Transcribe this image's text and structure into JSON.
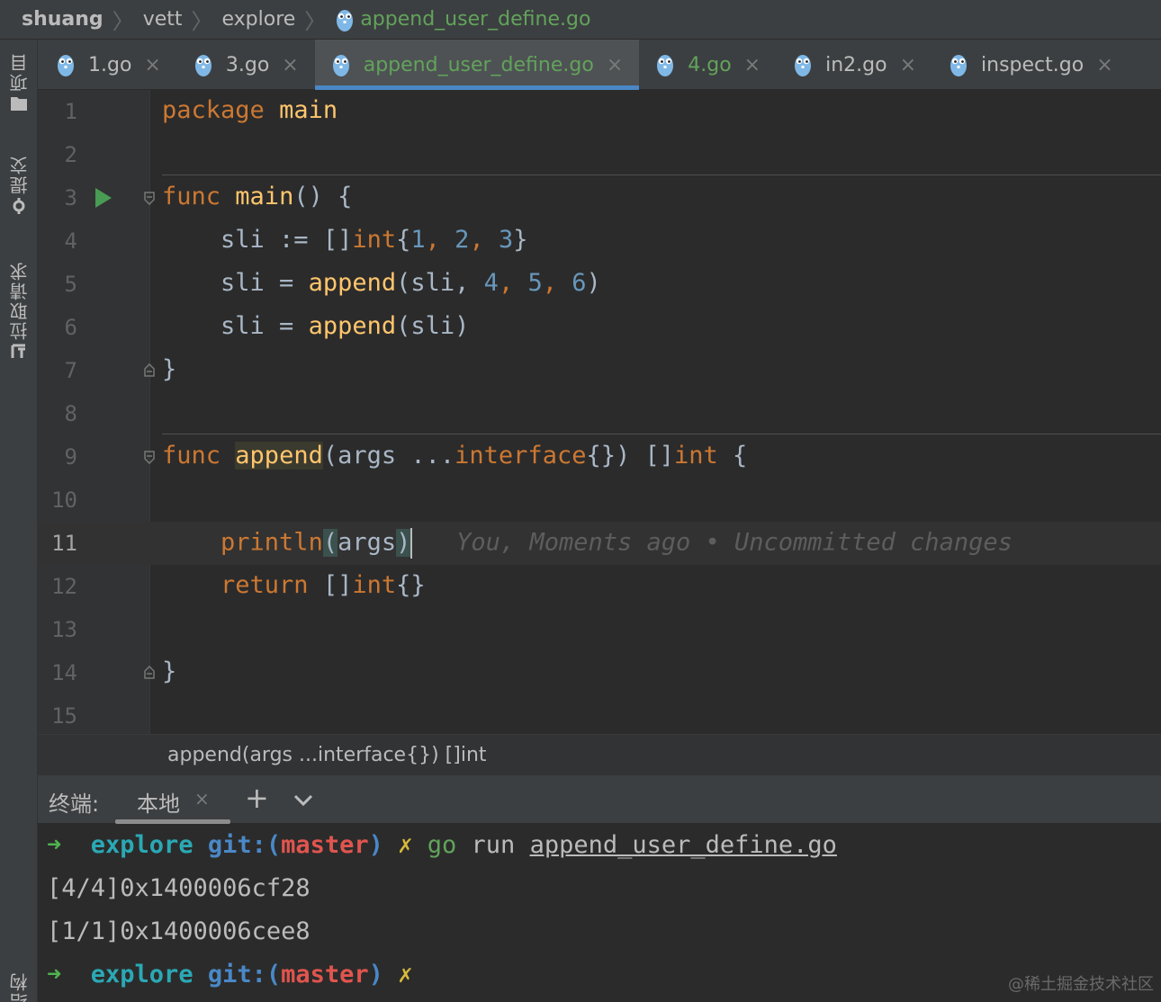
{
  "breadcrumb": {
    "items": [
      "shuang",
      "vett",
      "explore"
    ],
    "file": "append_user_define.go"
  },
  "left_strip": {
    "project_label": "项目",
    "commit_label": "提交",
    "pull_requests_label": "拉取请求",
    "structure_label": "结构"
  },
  "tabs": [
    {
      "label": "1.go",
      "active": false
    },
    {
      "label": "3.go",
      "active": false
    },
    {
      "label": "append_user_define.go",
      "active": true
    },
    {
      "label": "4.go",
      "active": false
    },
    {
      "label": "in2.go",
      "active": false
    },
    {
      "label": "inspect.go",
      "active": false
    }
  ],
  "editor": {
    "line_numbers": [
      "1",
      "2",
      "3",
      "4",
      "5",
      "6",
      "7",
      "8",
      "9",
      "10",
      "11",
      "12",
      "13",
      "14",
      "15"
    ],
    "current_line": "11",
    "code": {
      "l1_kw": "package",
      "l1_name": "main",
      "l3_kw": "func",
      "l3_fn": "main",
      "l3_rest": "() {",
      "l4_a": "sli := []",
      "l4_type": "int",
      "l4_b": "{",
      "l4_n1": "1",
      "l4_c1": ", ",
      "l4_n2": "2",
      "l4_c2": ", ",
      "l4_n3": "3",
      "l4_end": "}",
      "l5_a": "sli = ",
      "l5_fn": "append",
      "l5_b": "(sli, ",
      "l5_n1": "4",
      "l5_c1": ", ",
      "l5_n2": "5",
      "l5_c2": ", ",
      "l5_n3": "6",
      "l5_end": ")",
      "l6_a": "sli = ",
      "l6_fn": "append",
      "l6_b": "(sli)",
      "l7": "}",
      "l9_kw": "func",
      "l9_fn": "append",
      "l9_a": "(args ...",
      "l9_type": "interface",
      "l9_b": "{}) []",
      "l9_type2": "int",
      "l9_end": " {",
      "l11_fn": "println",
      "l11_open": "(",
      "l11_args": "args",
      "l11_close": ")",
      "l11_blame": "You, Moments ago • Uncommitted changes",
      "l12_kw": "return",
      "l12_a": " []",
      "l12_type": "int",
      "l12_b": "{}",
      "l14": "}"
    }
  },
  "hint": {
    "signature": "append(args ...interface{}) []int"
  },
  "terminal": {
    "title": "终端:",
    "tab_label": "本地",
    "prompt_arrow": "➜",
    "dir": "explore",
    "git_prefix": "git:(",
    "branch": "master",
    "git_suffix": ")",
    "dirty_mark": "✗",
    "cmd_go": "go",
    "cmd_run": "run",
    "cmd_file": "append_user_define.go",
    "output": [
      "[4/4]0x1400006cf28",
      "[1/1]0x1400006cee8"
    ]
  },
  "watermark": "@稀土掘金技术社区",
  "colors": {
    "keyword": "#cc7832",
    "function": "#ffc66d",
    "number": "#6897bb",
    "active_file": "#62a35b",
    "tab_underline": "#4a88c7"
  }
}
